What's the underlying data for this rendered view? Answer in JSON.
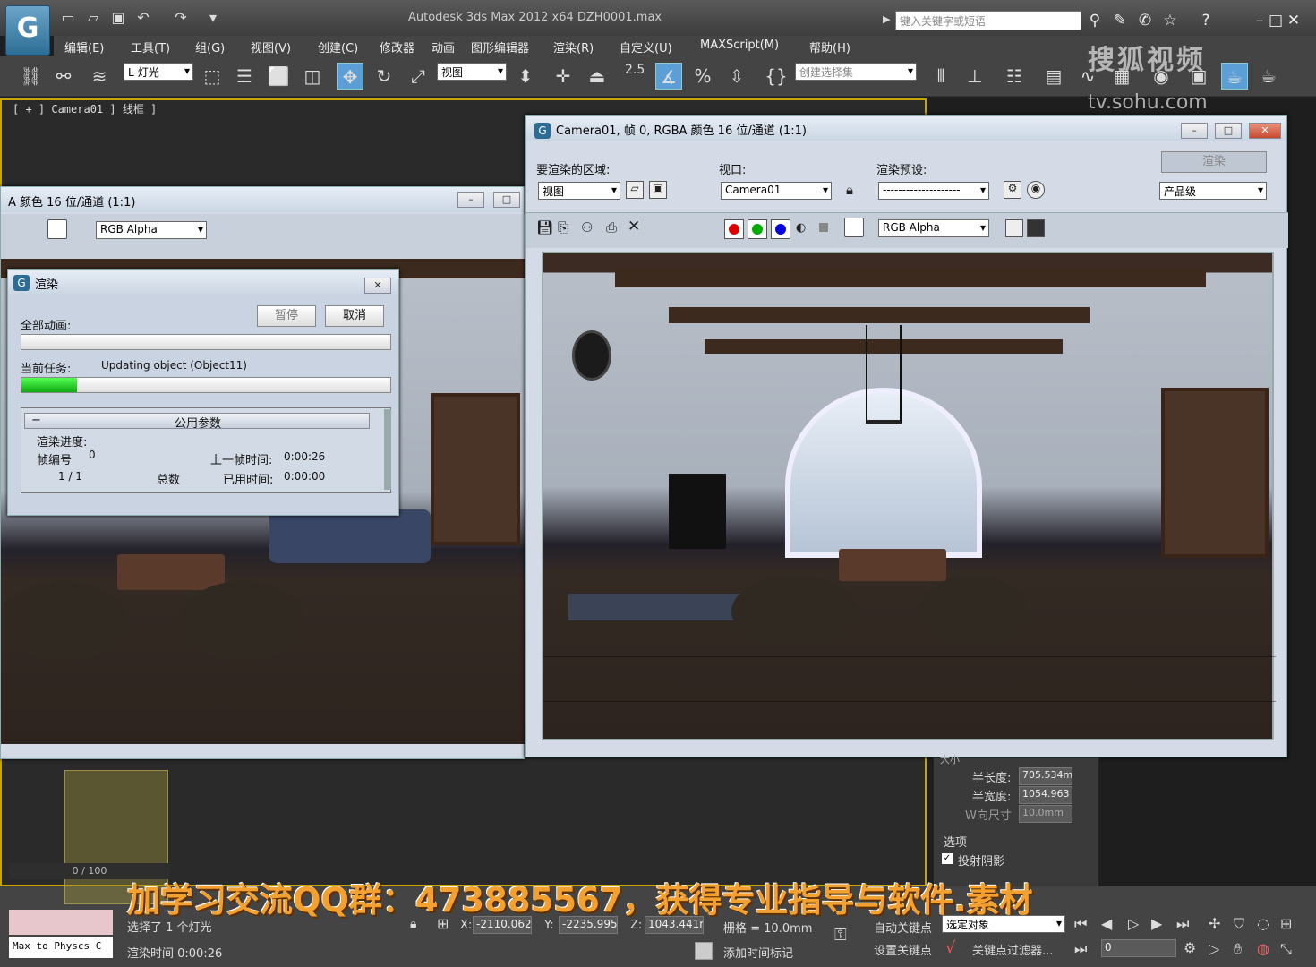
{
  "app": {
    "title": "Autodesk 3ds Max  2012 x64       DZH0001.max",
    "search_placeholder": "键入关键字或短语",
    "logo_char": "G"
  },
  "menu": [
    "编辑(E)",
    "工具(T)",
    "组(G)",
    "视图(V)",
    "创建(C)",
    "修改器",
    "动画",
    "图形编辑器",
    "渲染(R)",
    "自定义(U)",
    "MAXScript(M)",
    "帮助(H)"
  ],
  "toolbar": {
    "filter_value": "L-灯光",
    "ref_coord_value": "视图",
    "snap_value": "2.5",
    "selection_set_placeholder": "创建选择集"
  },
  "watermark": {
    "line1": "搜狐视频",
    "line2": "tv.sohu.com"
  },
  "viewport": {
    "label": "[ + ] Camera01 ] 线框 ]"
  },
  "bg_frame_window": {
    "title": "A 颜色 16 位/通道 (1:1)",
    "channel_value": "RGB Alpha"
  },
  "render_progress": {
    "title": "渲染",
    "pause_label": "暂停",
    "cancel_label": "取消",
    "total_anim_label": "全部动画:",
    "current_task_label": "当前任务:",
    "current_task_value": "Updating object (Object11)",
    "task_progress": 0.15,
    "rollout_title": "公用参数",
    "rollout_minus": "−",
    "progress_section": "渲染进度:",
    "frame_num_label": "帧编号",
    "frame_num_value": "0",
    "frame_count": "1 / 1",
    "total_label": "总数",
    "last_frame_label": "上一帧时间:",
    "last_frame_value": "0:00:26",
    "elapsed_label": "已用时间:",
    "elapsed_value": "0:00:00"
  },
  "frame_window": {
    "title": "Camera01, 帧 0, RGBA 颜色 16 位/通道 (1:1)",
    "area_label": "要渲染的区域:",
    "area_value": "视图",
    "viewport_label": "视口:",
    "viewport_value": "Camera01",
    "preset_label": "渲染预设:",
    "preset_value": "--------------------",
    "render_label": "渲染",
    "quality_value": "产品级",
    "channel_value": "RGB Alpha"
  },
  "right_panel": {
    "size_header": "大小",
    "half_length_label": "半长度:",
    "half_length_value": "705.534m",
    "half_width_label": "半宽度:",
    "half_width_value": "1054.963",
    "w_size_label": "W向尺寸",
    "w_size_value": "10.0mm",
    "options_header": "选项",
    "cast_shadow_label": "投射阴影"
  },
  "status": {
    "overlay": "加学习交流QQ群：473885567，获得专业指导与软件.素材",
    "timeline": "0 / 100",
    "script_label": "Max to Physcs C",
    "selected_msg": "选择了 1 个灯光",
    "render_time": "渲染时间 0:00:26",
    "x_label": "X:",
    "x_value": "-2110.062",
    "y_label": "Y:",
    "y_value": "-2235.995",
    "z_label": "Z:",
    "z_value": "1043.441m",
    "grid": "栅格 = 10.0mm",
    "add_time_tag": "添加时间标记",
    "auto_key": "自动关键点",
    "selected_obj": "选定对象",
    "set_key": "设置关键点",
    "key_filter": "关键点过滤器...",
    "frame_value": "0"
  },
  "colors": {
    "accent": "#5b9fd6",
    "progress_green": "#20c020",
    "viewport_border": "#c8a600",
    "overlay_text": "#f2a030"
  }
}
